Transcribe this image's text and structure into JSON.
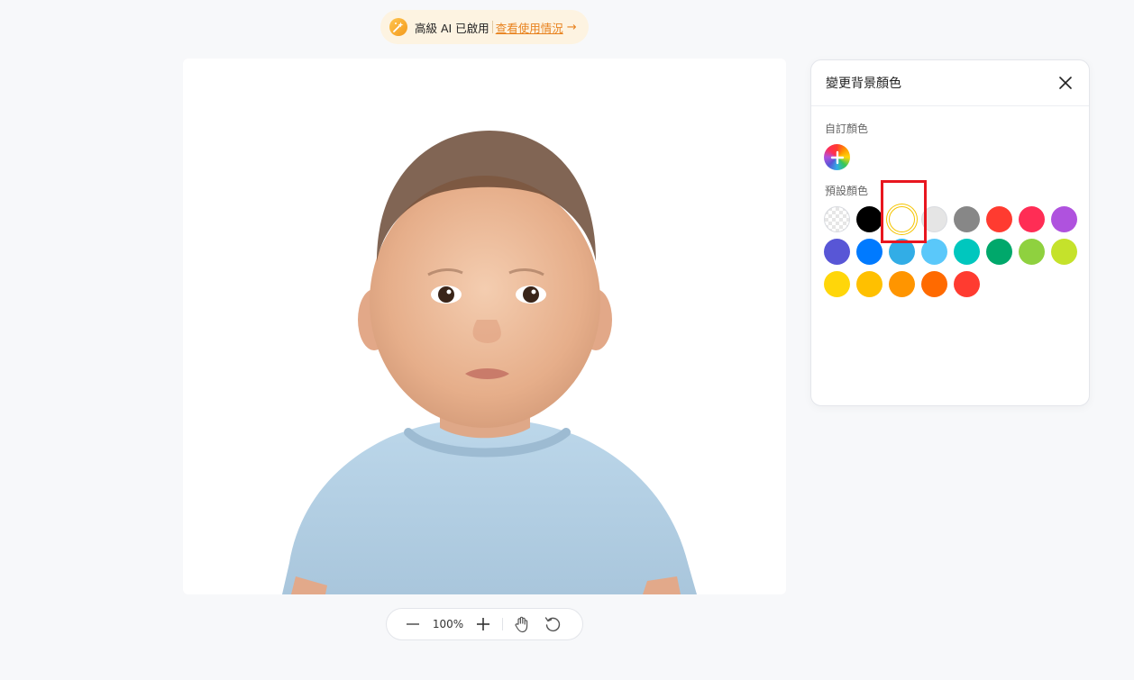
{
  "banner": {
    "label": "高級 AI 已啟用",
    "link": "查看使用情況",
    "arrow": "→",
    "icon": "sparkle-wand-icon"
  },
  "zoom": {
    "value": "100%",
    "zoom_out_icon": "minus-icon",
    "zoom_in_icon": "plus-icon",
    "pan_icon": "hand-icon",
    "reset_icon": "rotate-ccw-icon"
  },
  "panel": {
    "title": "變更背景顏色",
    "close_icon": "close-icon",
    "custom_label": "自訂顏色",
    "preset_label": "預設顏色",
    "selected_color": "#ffffff",
    "preset_colors": [
      {
        "name": "transparent",
        "hex": "transparent"
      },
      {
        "name": "black",
        "hex": "#000000"
      },
      {
        "name": "white",
        "hex": "#ffffff"
      },
      {
        "name": "light-gray",
        "hex": "#e5e5e5"
      },
      {
        "name": "gray",
        "hex": "#878787"
      },
      {
        "name": "red",
        "hex": "#ff3b30"
      },
      {
        "name": "pink-red",
        "hex": "#ff2d55"
      },
      {
        "name": "purple",
        "hex": "#af52de"
      },
      {
        "name": "indigo",
        "hex": "#5856d6"
      },
      {
        "name": "blue",
        "hex": "#007aff"
      },
      {
        "name": "sky-blue",
        "hex": "#32ade6"
      },
      {
        "name": "light-blue",
        "hex": "#5ac8fa"
      },
      {
        "name": "teal",
        "hex": "#00c7be"
      },
      {
        "name": "green",
        "hex": "#00a86b"
      },
      {
        "name": "lime-green",
        "hex": "#8fd13f"
      },
      {
        "name": "yellow-green",
        "hex": "#c5e22b"
      },
      {
        "name": "yellow",
        "hex": "#ffd60a"
      },
      {
        "name": "amber",
        "hex": "#ffc000"
      },
      {
        "name": "orange",
        "hex": "#ff9500"
      },
      {
        "name": "dark-orange",
        "hex": "#ff6a00"
      },
      {
        "name": "vermilion",
        "hex": "#ff3b30"
      }
    ]
  },
  "colors": {
    "page_bg": "#f7f8fa",
    "accent": "#e8821e",
    "highlight": "#e8161f"
  }
}
